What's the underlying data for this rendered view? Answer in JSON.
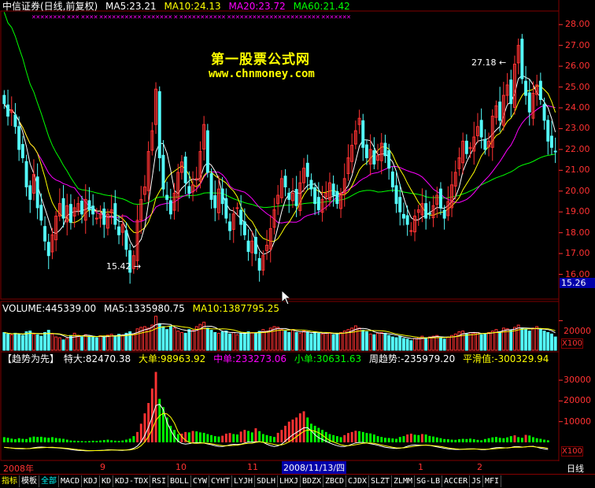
{
  "header": {
    "security": "中信证券(日线,前复权)",
    "ma5": "MA5:23.21",
    "ma10": "MA10:24.13",
    "ma20": "MA20:23.72",
    "ma60": "MA60:21.42",
    "cross_marks": "✕✕✕✕✕✕✕✕ ✕✕✕ ✕✕✕✕ ✕✕✕✕✕✕✕✕✕✕ ✕✕✕✕✕✕✕ ✕ ✕✕✕✕✕✕✕✕✕✕✕ ✕✕✕✕✕✕✕✕✕✕✕✕✕✕✕✕✕✕✕✕✕✕ ✕✕✕✕✕✕✕"
  },
  "watermark": {
    "line1": "第一股票公式网",
    "line2": "www.chnmoney.com"
  },
  "price_axis": {
    "ticks": [
      "28.00",
      "27.00",
      "26.00",
      "25.00",
      "24.00",
      "23.00",
      "22.00",
      "21.00",
      "20.00",
      "19.00",
      "18.00",
      "17.00",
      "16.00"
    ],
    "current": "15.26"
  },
  "annotations": {
    "high": "27.18",
    "low": "15.42"
  },
  "volume_header": {
    "volume": "VOLUME:445339.00",
    "ma5": "MA5:1335980.75",
    "ma10": "MA10:1387795.25"
  },
  "volume_axis": {
    "tick": "20000",
    "unit": "X100"
  },
  "trend_header": {
    "name": "【趋势为先】",
    "special": "特大:82470.38",
    "big": "大单:98963.92",
    "mid": "中单:233273.06",
    "small": "小单:30631.63",
    "week": "周趋势:-235979.20",
    "smooth": "平滑值:-300329.94"
  },
  "trend_axis": {
    "ticks": [
      "30000",
      "20000",
      "10000"
    ],
    "unit": "X100"
  },
  "date_axis": {
    "labels": [
      "2008年",
      "9",
      "10",
      "11",
      "2008/11/13/四",
      "1",
      "2"
    ],
    "right": "日线"
  },
  "tabs": [
    "指标",
    "模板",
    "全部",
    "MACD",
    "KDJ",
    "KD",
    "KDJ-TDX",
    "RSI",
    "BOLL",
    "CYW",
    "CYHT",
    "LYJH",
    "SDLH",
    "LHXJ",
    "BDZX",
    "ZBCD",
    "CJDX",
    "SLZT",
    "ZLMM",
    "SG-LB",
    "ACCER",
    "JS",
    "MFI"
  ],
  "colors": {
    "up": "#ff3232",
    "down": "#54ffff",
    "ma5": "#ffffff",
    "ma10": "#ffff00",
    "ma20": "#ff00ff",
    "ma60": "#00ff00",
    "grid": "#800000"
  },
  "chart_data": [
    {
      "type": "candlestick",
      "title": "中信证券(日线,前复权)",
      "ylim": [
        15.0,
        28.5
      ],
      "close": [
        24.2,
        23.6,
        23.9,
        23.1,
        22.0,
        21.6,
        20.2,
        19.6,
        20.8,
        19.2,
        18.6,
        17.6,
        16.9,
        17.9,
        18.8,
        19.4,
        18.7,
        19.3,
        18.5,
        19.2,
        19.4,
        18.9,
        19.6,
        19.1,
        18.9,
        18.7,
        18.9,
        18.4,
        18.9,
        19.1,
        18.4,
        17.9,
        18.4,
        17.2,
        16.1,
        16.9,
        18.6,
        19.6,
        20.2,
        21.9,
        22.9,
        24.9,
        21.6,
        20.1,
        19.6,
        18.9,
        19.9,
        20.9,
        21.4,
        20.4,
        19.9,
        20.3,
        20.6,
        21.9,
        23.2,
        20.9,
        19.6,
        19.2,
        20.1,
        19.4,
        18.7,
        18.1,
        18.9,
        19.2,
        18.4,
        17.9,
        17.1,
        17.6,
        17.0,
        16.2,
        16.9,
        17.4,
        18.2,
        19.1,
        19.8,
        20.6,
        20.2,
        19.6,
        19.9,
        19.3,
        20.4,
        21.1,
        20.7,
        20.1,
        19.4,
        19.1,
        19.6,
        19.9,
        20.4,
        19.8,
        19.4,
        19.9,
        20.6,
        21.6,
        22.2,
        22.9,
        23.5,
        22.1,
        21.6,
        22.0,
        21.3,
        21.7,
        22.3,
        21.7,
        21.1,
        20.2,
        19.4,
        19.0,
        18.7,
        18.4,
        18.1,
        18.8,
        19.1,
        19.4,
        18.7,
        18.9,
        19.3,
        19.8,
        19.2,
        18.7,
        19.5,
        20.3,
        20.9,
        21.6,
        22.4,
        21.8,
        22.1,
        22.6,
        23.1,
        22.6,
        22.0,
        22.4,
        23.6,
        24.1,
        23.4,
        24.6,
        25.1,
        24.2,
        26.1,
        27.0,
        25.4,
        24.6,
        23.8,
        24.7,
        25.1,
        24.4,
        23.4,
        22.4,
        22.1,
        21.9
      ],
      "volume": [
        12000,
        11000,
        10500,
        11500,
        11000,
        10000,
        12500,
        13000,
        11000,
        10500,
        9500,
        12000,
        13500,
        11000,
        9000,
        8500,
        7000,
        8000,
        10000,
        11500,
        10000,
        9000,
        10500,
        9500,
        8800,
        8500,
        9800,
        9000,
        10200,
        10800,
        9400,
        10800,
        10300,
        11500,
        12500,
        11000,
        14500,
        15500,
        16000,
        15000,
        17000,
        23000,
        18000,
        16000,
        14000,
        16000,
        15000,
        13000,
        12000,
        11500,
        14000,
        13500,
        16000,
        17500,
        19000,
        15000,
        13500,
        12000,
        11500,
        12500,
        13000,
        11000,
        12000,
        10500,
        11500,
        12000,
        12500,
        12000,
        11500,
        12800,
        14000,
        13000,
        15000,
        16000,
        15500,
        14000,
        13000,
        12000,
        14000,
        12000,
        11500,
        13000,
        12000,
        11000,
        12500,
        11500,
        11000,
        11500,
        12000,
        10500,
        11000,
        12000,
        13000,
        14000,
        15000,
        16500,
        15000,
        13500,
        12500,
        11000,
        10500,
        11500,
        12000,
        11500,
        10000,
        9000,
        8500,
        9500,
        8000,
        7500,
        6500,
        8000,
        8500,
        9500,
        8500,
        9000,
        9500,
        10000,
        8500,
        7500,
        9000,
        10000,
        11000,
        12500,
        13000,
        11000,
        12000,
        11500,
        12000,
        10500,
        11000,
        12000,
        13000,
        14000,
        12500,
        15000,
        14500,
        13500,
        15500,
        17000,
        15000,
        14000,
        13000,
        15000,
        16000,
        14000,
        13000,
        12000,
        11000,
        9000
      ],
      "trend_bars": [
        2500,
        2200,
        1800,
        1500,
        2000,
        1700,
        1600,
        2400,
        2800,
        2600,
        2700,
        2400,
        2200,
        2500,
        2100,
        1900,
        1700,
        1300,
        900,
        800,
        700,
        600,
        500,
        600,
        800,
        700,
        900,
        1100,
        1300,
        1000,
        800,
        700,
        900,
        1300,
        1800,
        3000,
        5000,
        9000,
        14000,
        19000,
        26000,
        34000,
        21000,
        17000,
        12000,
        8000,
        6000,
        4000,
        4200,
        5000,
        4800,
        5500,
        5300,
        4800,
        4600,
        4000,
        3500,
        3000,
        2800,
        3200,
        4200,
        4500,
        4000,
        3800,
        5200,
        6000,
        5500,
        4800,
        6800,
        5400,
        4000,
        3500,
        3000,
        2600,
        4600,
        6000,
        8000,
        10000,
        11000,
        12000,
        14000,
        15000,
        12000,
        9000,
        8000,
        7000,
        6000,
        5000,
        4000,
        3500,
        3000,
        2500,
        3500,
        4500,
        5000,
        5600,
        5400,
        5000,
        4500,
        4300,
        3800,
        3000,
        2600,
        2200,
        2100,
        1900,
        1700,
        2600,
        3000,
        3800,
        4200,
        3700,
        3500,
        4000,
        3800,
        3100,
        2800,
        2400,
        2000,
        1600,
        1500,
        1300,
        1200,
        1500,
        1700,
        1600,
        1800,
        1500,
        1200,
        1000,
        1600,
        2000,
        2400,
        2600,
        2200,
        2000,
        2400,
        3000,
        3400,
        2500,
        2200,
        3600,
        3300,
        2500,
        2000,
        1700,
        1300,
        1000
      ]
    }
  ]
}
